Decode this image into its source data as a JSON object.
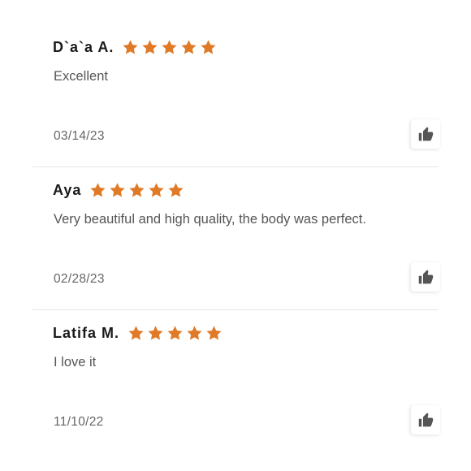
{
  "colors": {
    "star": "#e07a27",
    "thumb": "#555555",
    "divider": "#e6e6e6"
  },
  "reviews": [
    {
      "name": "D`a`a A.",
      "rating": 5,
      "text": "Excellent",
      "date": "03/14/23",
      "helpful_icon": "thumbs-up-icon"
    },
    {
      "name": "Aya",
      "rating": 5,
      "text": "Very beautiful and high quality, the body was perfect.",
      "date": "02/28/23",
      "helpful_icon": "thumbs-up-icon"
    },
    {
      "name": "Latifa M.",
      "rating": 5,
      "text": "I love it",
      "date": "11/10/22",
      "helpful_icon": "thumbs-up-icon"
    }
  ]
}
